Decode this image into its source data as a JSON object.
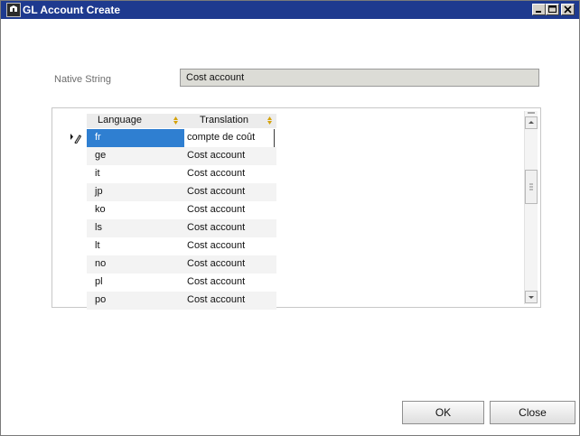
{
  "window": {
    "title": "GL Account Create",
    "title_bar_color": "#1e3a8f",
    "controls": {
      "minimize_icon": "minimize-icon",
      "maximize_icon": "maximize-icon",
      "close_icon": "close-icon"
    }
  },
  "native": {
    "label": "Native String",
    "value": "Cost account"
  },
  "grid": {
    "columns": {
      "language": "Language",
      "translation": "Translation"
    },
    "selected_row": 0,
    "selection_color": "#2f7fd1",
    "rows": [
      {
        "language": "fr",
        "translation": "compte de coût"
      },
      {
        "language": "ge",
        "translation": "Cost account"
      },
      {
        "language": "it",
        "translation": "Cost account"
      },
      {
        "language": "jp",
        "translation": "Cost account"
      },
      {
        "language": "ko",
        "translation": "Cost account"
      },
      {
        "language": "ls",
        "translation": "Cost account"
      },
      {
        "language": "lt",
        "translation": "Cost account"
      },
      {
        "language": "no",
        "translation": "Cost account"
      },
      {
        "language": "pl",
        "translation": "Cost account"
      },
      {
        "language": "po",
        "translation": "Cost account"
      }
    ]
  },
  "buttons": {
    "ok": "OK",
    "close": "Close"
  }
}
